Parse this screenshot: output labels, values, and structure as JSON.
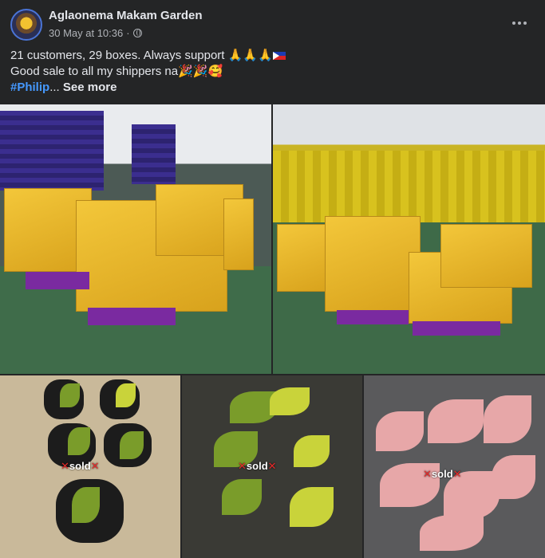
{
  "post": {
    "author": "Aglaonema Makam Garden",
    "date": "30 May at 10:36",
    "separator": "·",
    "line1": "21 customers, 29 boxes. Always support",
    "line1_emoji": "🙏🙏🙏",
    "line2": "Good sale to all my shippers na",
    "line2_emoji": "🎉🎉🥰",
    "hashtag": "#Philip",
    "ellipsis": "...",
    "see_more": "See more"
  },
  "photos": {
    "photo3_label": "sold",
    "photo4_label": "sold",
    "photo5_label": "sold",
    "mark": "✕"
  },
  "colors": {
    "background": "#242526",
    "text_primary": "#e4e6eb",
    "text_secondary": "#b0b3b8",
    "link": "#4599ff",
    "sold_mark": "#e52b2b"
  },
  "icons": [
    "avatar",
    "globe-icon",
    "more-options-icon",
    "philippines-flag-icon"
  ]
}
